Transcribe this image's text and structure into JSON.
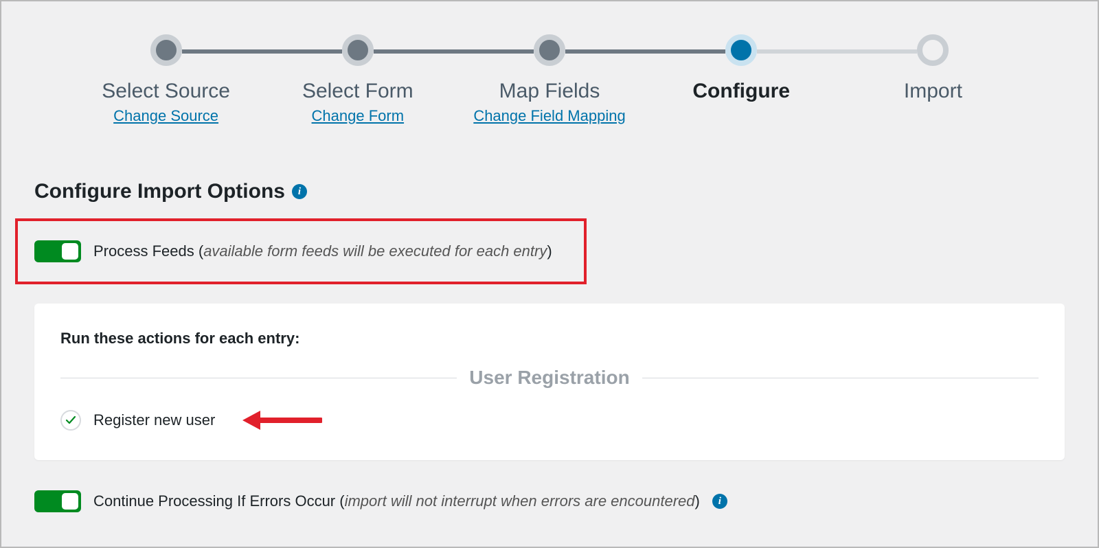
{
  "stepper": {
    "steps": [
      {
        "label": "Select Source",
        "sublink": "Change Source",
        "state": "done"
      },
      {
        "label": "Select Form",
        "sublink": "Change Form",
        "state": "done"
      },
      {
        "label": "Map Fields",
        "sublink": "Change Field Mapping",
        "state": "done"
      },
      {
        "label": "Configure",
        "sublink": "",
        "state": "current"
      },
      {
        "label": "Import",
        "sublink": "",
        "state": "upcoming"
      }
    ]
  },
  "section": {
    "heading": "Configure Import Options"
  },
  "process_feeds": {
    "enabled": true,
    "label": "Process Feeds",
    "hint_open": " (",
    "hint": "available form feeds will be executed for each entry",
    "hint_close": ")"
  },
  "actions_panel": {
    "heading": "Run these actions for each entry:",
    "group_label": "User Registration",
    "items": [
      {
        "label": "Register new user",
        "checked": true
      }
    ]
  },
  "continue_on_error": {
    "enabled": true,
    "label": "Continue Processing If Errors Occur",
    "hint_open": " (",
    "hint": "import will not interrupt when errors are encountered",
    "hint_close": ")"
  },
  "colors": {
    "accent": "#0073aa",
    "success": "#008a20",
    "highlight_border": "#e1202b",
    "stepper_done": "#6d7882",
    "stepper_done_ring": "#c9ced3",
    "panel_bg": "#ffffff",
    "page_bg": "#f0f0f1"
  }
}
